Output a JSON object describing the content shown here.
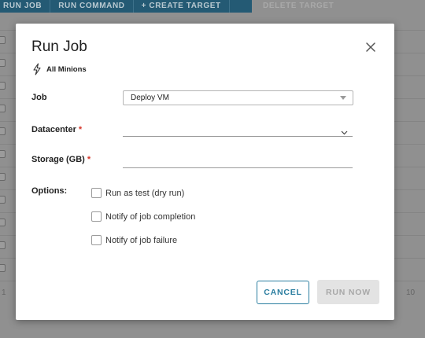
{
  "background": {
    "toolbar": [
      "RUN JOB",
      "RUN COMMAND",
      "+ CREATE TARGET"
    ],
    "toolbar_disabled": "DELETE TARGET",
    "pager_left": "1",
    "pager_right": "10"
  },
  "modal": {
    "title": "Run Job",
    "target_icon": "lightning-bolt-icon",
    "target_label": "All Minions",
    "close_icon": "close-icon",
    "fields": {
      "job_label": "Job",
      "job_value": "Deploy VM",
      "datacenter_label": "Datacenter",
      "datacenter_value": "",
      "storage_label": "Storage (GB)",
      "storage_value": "",
      "required_marker": "*"
    },
    "options_label": "Options:",
    "options": [
      {
        "label": "Run as test (dry run)",
        "checked": false
      },
      {
        "label": "Notify of job completion",
        "checked": false
      },
      {
        "label": "Notify of job failure",
        "checked": false
      }
    ],
    "buttons": {
      "cancel": "CANCEL",
      "run_now": "RUN NOW"
    }
  },
  "colors": {
    "accent": "#2b7ea0",
    "required": "#d6372b",
    "toolbar_bg": "#1f5d7a",
    "disabled_bg": "#e3e3e3"
  }
}
